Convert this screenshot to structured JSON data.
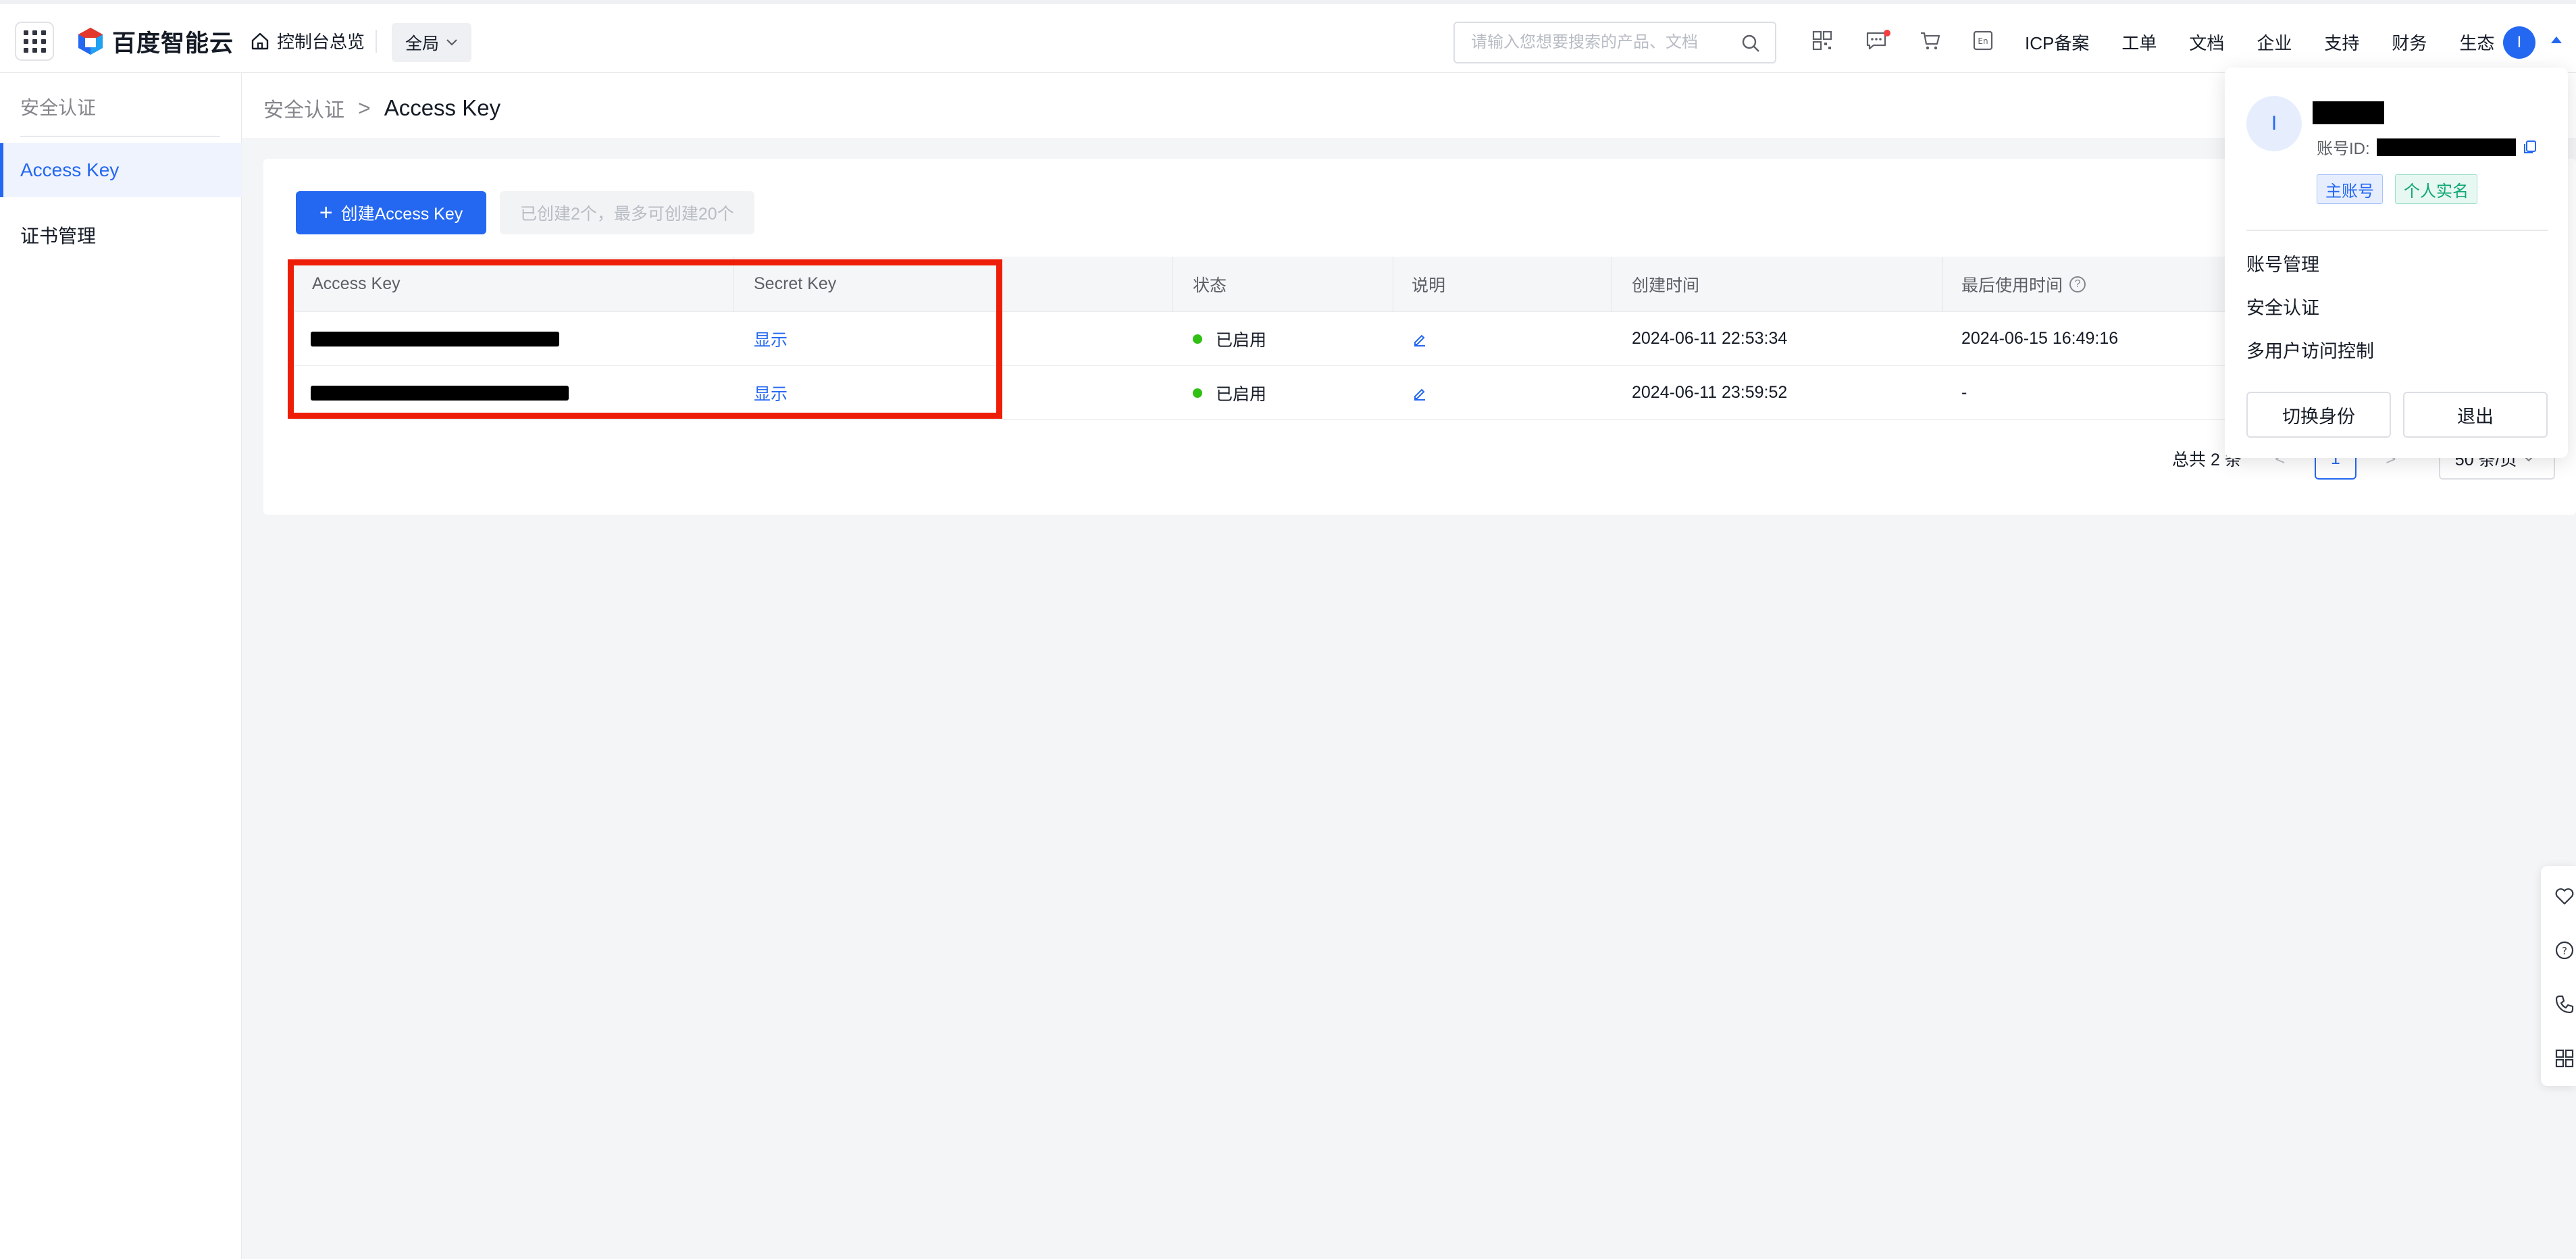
{
  "topbar": {
    "brand": "百度智能云",
    "console_home": "控制台总览",
    "region": "全局",
    "search_placeholder": "请输入您想要搜索的产品、文档",
    "links": [
      "ICP备案",
      "工单",
      "文档",
      "企业",
      "支持",
      "财务",
      "生态"
    ],
    "avatar_initial": "I"
  },
  "sidebar": {
    "title": "安全认证",
    "items": [
      {
        "label": "Access Key",
        "active": true
      },
      {
        "label": "证书管理",
        "active": false
      }
    ]
  },
  "breadcrumb": {
    "parent": "安全认证",
    "separator": ">",
    "current": "Access Key"
  },
  "toolbar": {
    "create_label": "创建Access Key",
    "quota_tip": "已创建2个，最多可创建20个"
  },
  "table": {
    "columns": [
      "Access Key",
      "Secret Key",
      "状态",
      "说明",
      "创建时间",
      "最后使用时间"
    ],
    "rows": [
      {
        "secret_action": "显示",
        "status": "已启用",
        "created": "2024-06-11 22:53:34",
        "last_used": "2024-06-15 16:49:16"
      },
      {
        "secret_action": "显示",
        "status": "已启用",
        "created": "2024-06-11 23:59:52",
        "last_used": "-"
      }
    ]
  },
  "pagination": {
    "total_text": "总共 2 条",
    "current_page": "1",
    "page_size": "50 条/页"
  },
  "user_menu": {
    "avatar_initial": "I",
    "account_id_label": "账号ID:",
    "tags": [
      "主账号",
      "个人实名"
    ],
    "items": [
      "账号管理",
      "安全认证",
      "多用户访问控制"
    ],
    "switch_label": "切换身份",
    "logout_label": "退出"
  },
  "colors": {
    "primary": "#2468f2",
    "status_enabled": "#30bf13",
    "highlight": "#ee1d07"
  }
}
